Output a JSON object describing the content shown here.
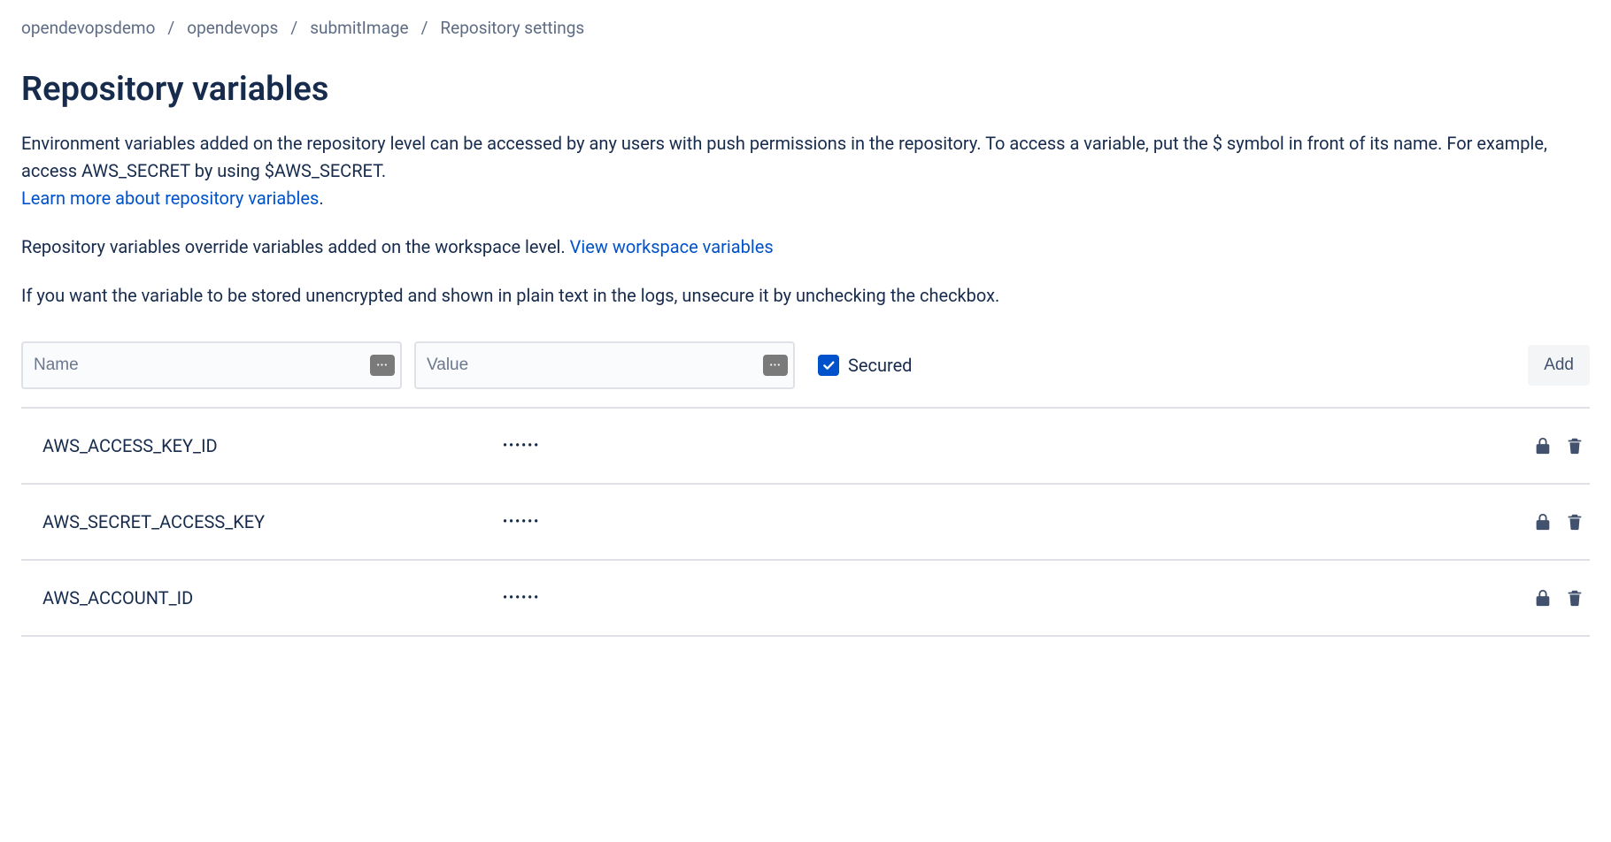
{
  "breadcrumb": {
    "items": [
      "opendevopsdemo",
      "opendevops",
      "submitImage",
      "Repository settings"
    ]
  },
  "page": {
    "title": "Repository variables",
    "desc1_a": "Environment variables added on the repository level can be accessed by any users with push permissions in the repository. To access a variable, put the $ symbol in front of its name. For example, access AWS_SECRET by using $AWS_SECRET.",
    "learn_link": "Learn more about repository variables",
    "desc2_a": "Repository variables override variables added on the workspace level. ",
    "workspace_link": "View workspace variables",
    "desc3": "If you want the variable to be stored unencrypted and shown in plain text in the logs, unsecure it by unchecking the checkbox."
  },
  "form": {
    "name_placeholder": "Name",
    "value_placeholder": "Value",
    "secured_label": "Secured",
    "secured_checked": true,
    "add_label": "Add"
  },
  "variables": [
    {
      "name": "AWS_ACCESS_KEY_ID",
      "value_masked": "••••••"
    },
    {
      "name": "AWS_SECRET_ACCESS_KEY",
      "value_masked": "••••••"
    },
    {
      "name": "AWS_ACCOUNT_ID",
      "value_masked": "••••••"
    }
  ]
}
